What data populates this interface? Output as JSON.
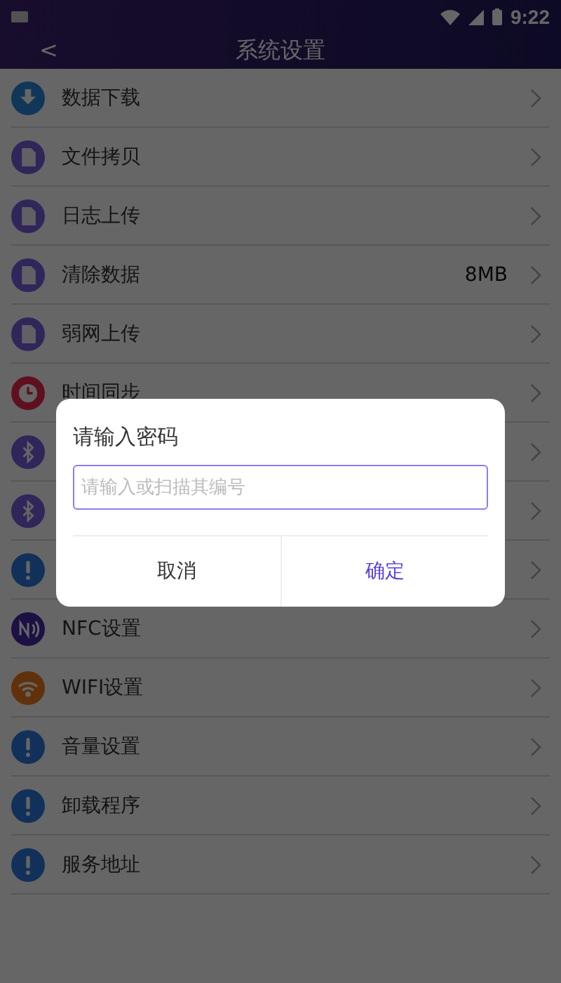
{
  "status_bar": {
    "time": "9:22"
  },
  "header": {
    "back": "<",
    "title": "系统设置"
  },
  "settings": [
    {
      "kind": "download",
      "label": "数据下载"
    },
    {
      "kind": "file",
      "label": "文件拷贝"
    },
    {
      "kind": "file",
      "label": "日志上传"
    },
    {
      "kind": "file",
      "label": "清除数据",
      "value": "8MB"
    },
    {
      "kind": "file",
      "label": "弱网上传"
    },
    {
      "kind": "clock",
      "label": "时间同步"
    },
    {
      "kind": "bluetooth"
    },
    {
      "kind": "bluetooth"
    },
    {
      "kind": "alert"
    },
    {
      "kind": "nfc",
      "label": "NFC设置"
    },
    {
      "kind": "wifi",
      "label": "WIFI设置"
    },
    {
      "kind": "alert",
      "label": "音量设置"
    },
    {
      "kind": "alert",
      "label": "卸载程序"
    },
    {
      "kind": "alert",
      "label": "服务地址"
    }
  ],
  "dialog": {
    "title": "请输入密码",
    "input": {
      "placeholder": "请输入或扫描其编号"
    },
    "buttons": [
      {
        "label": "取消",
        "kind": "cancel"
      },
      {
        "label": "确定",
        "kind": "confirm"
      }
    ]
  }
}
